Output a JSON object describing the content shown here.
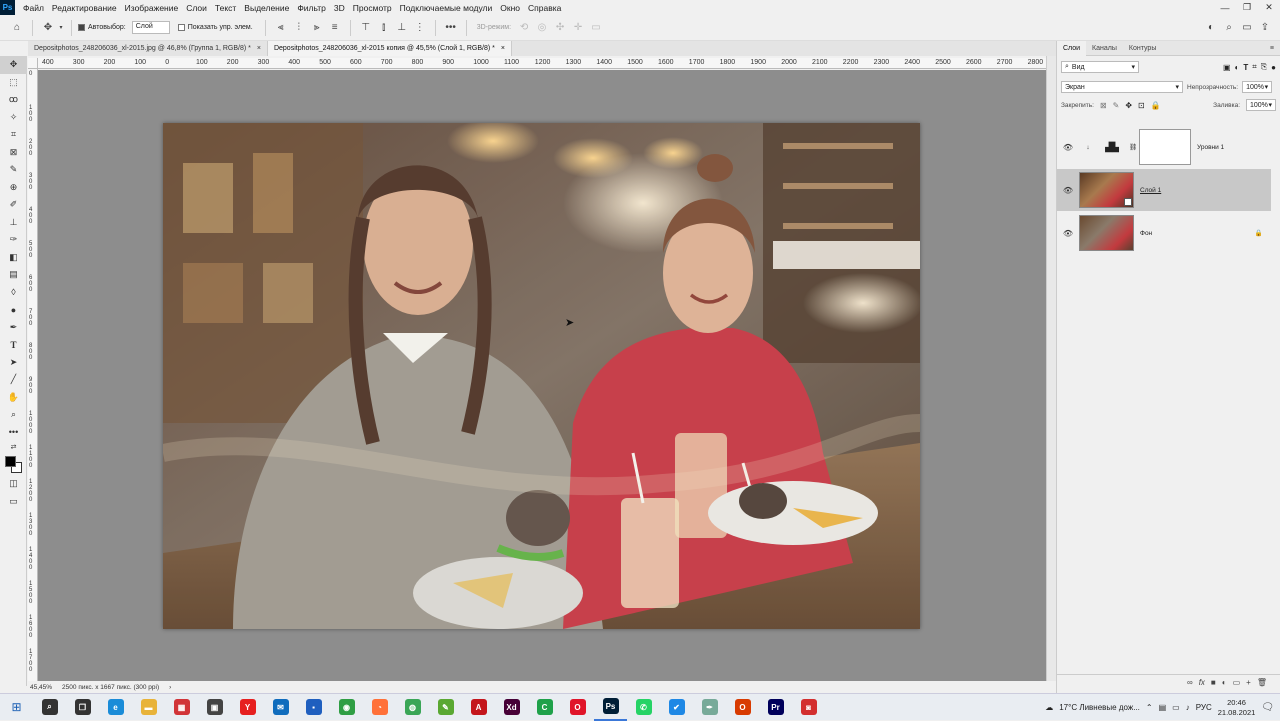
{
  "menubar": {
    "logo": "Ps",
    "items": [
      "Файл",
      "Редактирование",
      "Изображение",
      "Слои",
      "Текст",
      "Выделение",
      "Фильтр",
      "3D",
      "Просмотр",
      "Подключаемые модули",
      "Окно",
      "Справка"
    ],
    "window_controls": [
      "—",
      "❐",
      "✕"
    ]
  },
  "options": {
    "autoselect_label": "Автовыбор:",
    "autoselect_value": "Слой",
    "show_controls_label": "Показать упр. элем.",
    "mode_3d_label": "3D-режим:"
  },
  "tabs": [
    {
      "label": "Depositphotos_248206036_xl-2015.jpg @ 46,8% (Группа 1, RGB/8) *",
      "close": "×"
    },
    {
      "label": "Depositphotos_248206036_xl-2015 копия @ 45,5% (Слой 1, RGB/8) *",
      "close": "×"
    }
  ],
  "ruler": {
    "top": [
      "400",
      "300",
      "200",
      "100",
      "0",
      "100",
      "200",
      "300",
      "400",
      "500",
      "600",
      "700",
      "800",
      "900",
      "1000",
      "1100",
      "1200",
      "1300",
      "1400",
      "1500",
      "1600",
      "1700",
      "1800",
      "1900",
      "2000",
      "2100",
      "2200",
      "2300",
      "2400",
      "2500",
      "2600",
      "2700",
      "2800"
    ],
    "left": [
      "0",
      "1 0 0",
      "2 0 0",
      "3 0 0",
      "4 0 0",
      "5 0 0",
      "6 0 0",
      "7 0 0",
      "8 0 0",
      "9 0 0",
      "1 0 0 0",
      "1 1 0 0",
      "1 2 0 0",
      "1 3 0 0",
      "1 4 0 0",
      "1 5 0 0",
      "1 6 0 0",
      "1 7 0 0"
    ]
  },
  "status": {
    "zoom": "45,45%",
    "doc_info": "2500 пикс. x 1667 пикс. (300 ppi)",
    "arrow": "›"
  },
  "panel": {
    "tabs": [
      "Слои",
      "Каналы",
      "Контуры"
    ],
    "filter_label": "Вид",
    "blend_mode": "Экран",
    "opacity_label": "Непрозрачность:",
    "opacity_value": "100%",
    "lock_label": "Закрепить:",
    "fill_label": "Заливка:",
    "fill_value": "100%",
    "layers": [
      {
        "name": "Уровни 1",
        "type": "adjustment"
      },
      {
        "name": "Слой 1",
        "type": "image",
        "selected": true
      },
      {
        "name": "Фон",
        "type": "background",
        "locked": true
      }
    ],
    "bottom_icons": [
      "∞",
      "fx",
      "■",
      "◐",
      "▭",
      "+",
      "🗑"
    ]
  },
  "taskbar": {
    "weather": "17°C  Ливневые дож...",
    "lang": "РУС",
    "time": "20:46",
    "date": "21.08.2021",
    "apps": [
      {
        "name": "search",
        "glyph": "⌕",
        "color": "#333333"
      },
      {
        "name": "task-view",
        "glyph": "❐",
        "color": "#333333"
      },
      {
        "name": "edge",
        "glyph": "e",
        "color": "#1a8cd8"
      },
      {
        "name": "explorer",
        "glyph": "▬",
        "color": "#e8b33a"
      },
      {
        "name": "photos",
        "glyph": "▦",
        "color": "#d13438"
      },
      {
        "name": "store",
        "glyph": "▣",
        "color": "#444444"
      },
      {
        "name": "yandex",
        "glyph": "Y",
        "color": "#e62020"
      },
      {
        "name": "mail",
        "glyph": "✉",
        "color": "#0f6cbd"
      },
      {
        "name": "save",
        "glyph": "▪",
        "color": "#1f5fbf"
      },
      {
        "name": "chrome",
        "glyph": "◉",
        "color": "#2f9e44"
      },
      {
        "name": "firefox",
        "glyph": "◔",
        "color": "#ff7139"
      },
      {
        "name": "green-app",
        "glyph": "◍",
        "color": "#3aa657"
      },
      {
        "name": "edit-app",
        "glyph": "✎",
        "color": "#5aa832"
      },
      {
        "name": "acrobat",
        "glyph": "A",
        "color": "#c4161c"
      },
      {
        "name": "xd",
        "glyph": "Xd",
        "color": "#470137"
      },
      {
        "name": "camtasia",
        "glyph": "C",
        "color": "#1fa14a"
      },
      {
        "name": "opera",
        "glyph": "O",
        "color": "#e0152a"
      },
      {
        "name": "photoshop",
        "glyph": "Ps",
        "color": "#001e36"
      },
      {
        "name": "whatsapp",
        "glyph": "✆",
        "color": "#25d366"
      },
      {
        "name": "check-app",
        "glyph": "✔",
        "color": "#1e88e5"
      },
      {
        "name": "pen-app",
        "glyph": "✒",
        "color": "#7a9"
      },
      {
        "name": "office",
        "glyph": "O",
        "color": "#d83b01"
      },
      {
        "name": "premiere",
        "glyph": "Pr",
        "color": "#00005b"
      },
      {
        "name": "recorder",
        "glyph": "◙",
        "color": "#d32f2f"
      }
    ]
  }
}
